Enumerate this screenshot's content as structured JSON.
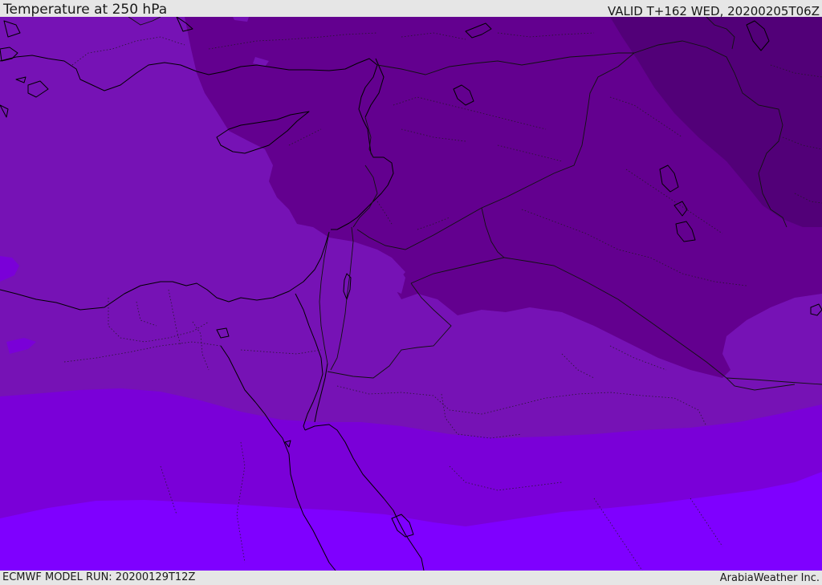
{
  "header": {
    "title": "Temperature at 250 hPa",
    "valid_time": "VALID T+162 WED, 20200205T06Z"
  },
  "footer": {
    "model_run": "ECMWF MODEL RUN: 20200129T12Z",
    "credit": "ArabiaWeather Inc."
  },
  "map": {
    "region": "Middle East and North Africa",
    "layers": [
      "temperature-shading",
      "coastlines",
      "country-borders",
      "province-borders"
    ],
    "colors": {
      "band_darkest": "#520078",
      "band_dark": "#63008f",
      "band_mid": "#7612b5",
      "band_light": "#7a00d8",
      "band_lightest": "#7f00ff"
    }
  }
}
